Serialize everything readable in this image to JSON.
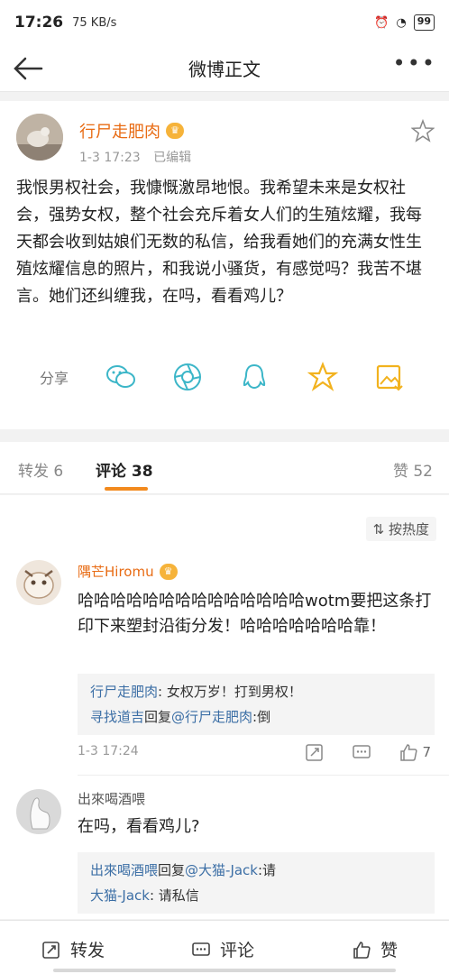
{
  "status_bar": {
    "time": "17:26",
    "network": "75 KB/s",
    "battery": "99"
  },
  "nav": {
    "title": "微博正文"
  },
  "post": {
    "author": "行尸走肥肉",
    "time": "1-3 17:23",
    "edited": "已编辑",
    "text": "我恨男权社会，我慷慨激昂地恨。我希望未来是女权社会，强势女权，整个社会充斥着女人们的生殖炫耀，我每天都会收到姑娘们无数的私信，给我看她们的充满女性生殖炫耀信息的照片，和我说小骚货，有感觉吗？我苦不堪言。她们还纠缠我，在吗，看看鸡儿？",
    "share_label": "分享"
  },
  "tabs": {
    "repost": "转发 6",
    "comments": "评论 38",
    "likes": "赞 52"
  },
  "sort_label": "按热度",
  "comments": [
    {
      "name": "隅芒Hiromu",
      "text": "哈哈哈哈哈哈哈哈哈哈哈哈哈哈wotm要把这条打印下来塑封沿街分发！哈哈哈哈哈哈哈靠！",
      "replies": [
        {
          "user": "行尸走肥肉",
          "pre": "",
          "mid": "",
          "target": "",
          "content": ": 女权万岁！打到男权！"
        },
        {
          "user": "寻找道吉",
          "pre": "",
          "mid": "回复",
          "target": "@行尸走肥肉",
          "content": ":倒"
        }
      ],
      "time": "1-3 17:24",
      "likes": "7"
    },
    {
      "name": "出來喝酒喂",
      "text": "在吗，看看鸡儿?",
      "replies": [
        {
          "user": "出來喝酒喂",
          "mid": "回复",
          "target": "@大猫-Jack",
          "content": ":请"
        },
        {
          "user": "大猫-Jack",
          "mid": "",
          "target": "",
          "content": ": 请私信"
        }
      ]
    }
  ],
  "bottom_bar": {
    "repost": "转发",
    "comment": "评论",
    "like": "赞"
  },
  "colors": {
    "orange": "#e86b13",
    "link": "#3b6ea5",
    "accent": "#f28a1e"
  }
}
